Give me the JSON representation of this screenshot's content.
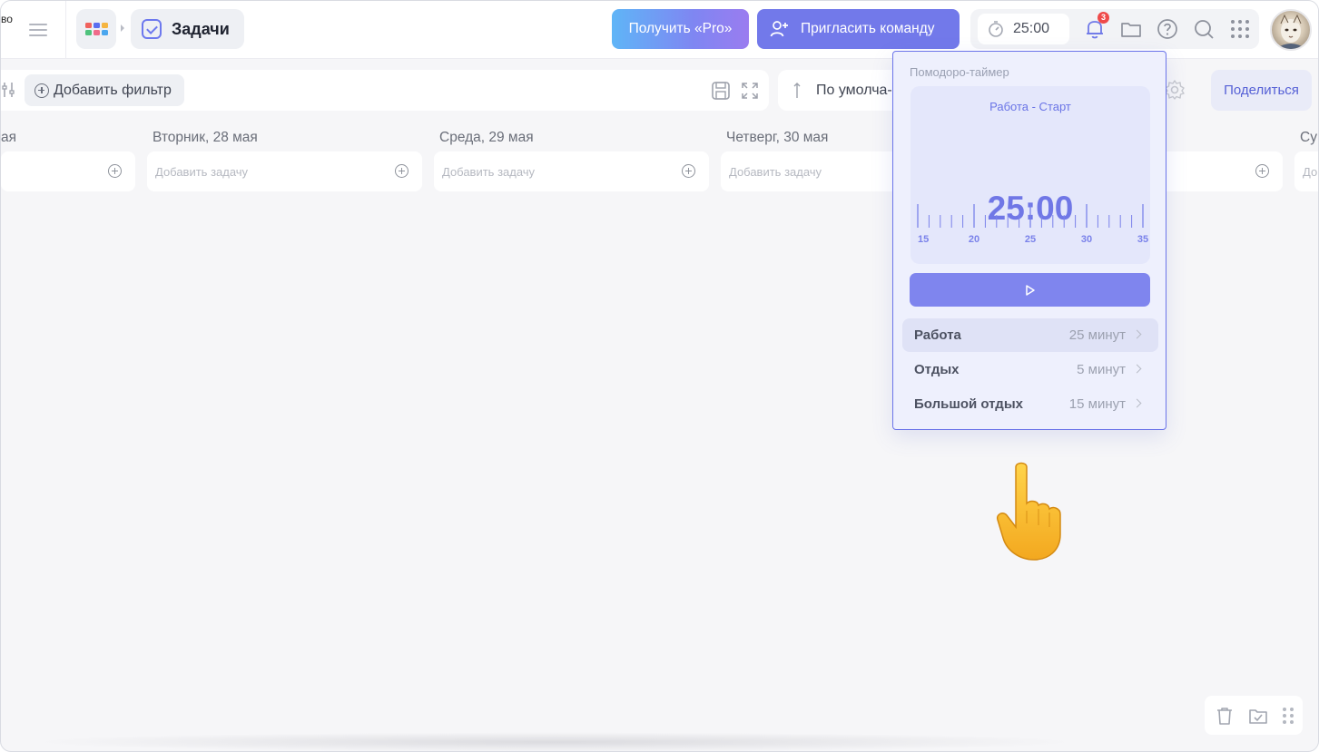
{
  "topbar": {
    "workspace_cut": "во",
    "section_title": "Задачи",
    "pro_label": "Получить «Pro»",
    "invite_label": "Пригласить команду",
    "timer_value": "25:00",
    "notifications_count": "3"
  },
  "filters": {
    "add_filter_label": "Добавить фильтр",
    "sort_label": "По умолча-",
    "share_label": "Поделиться"
  },
  "days": [
    {
      "header": "ая",
      "placeholder": ""
    },
    {
      "header": "Вторник, 28 мая",
      "placeholder": "Добавить задачу"
    },
    {
      "header": "Среда, 29 мая",
      "placeholder": "Добавить задачу"
    },
    {
      "header": "Четверг, 30 мая",
      "placeholder": "Добавить задачу"
    },
    {
      "header": "",
      "placeholder": ""
    },
    {
      "header": "Су",
      "placeholder": "До"
    }
  ],
  "pomodoro": {
    "title": "Помодоро-таймер",
    "status": "Работа - Старт",
    "time": "25:00",
    "scale_labels": [
      "15",
      "20",
      "25",
      "30",
      "35"
    ],
    "rows": [
      {
        "label": "Работа",
        "value": "25 минут"
      },
      {
        "label": "Отдых",
        "value": "5 минут"
      },
      {
        "label": "Большой отдых",
        "value": "15 минут"
      }
    ]
  },
  "colors": {
    "accent": "#7279ea",
    "timer_text": "#7077e6",
    "badge": "#ef4a4a"
  }
}
